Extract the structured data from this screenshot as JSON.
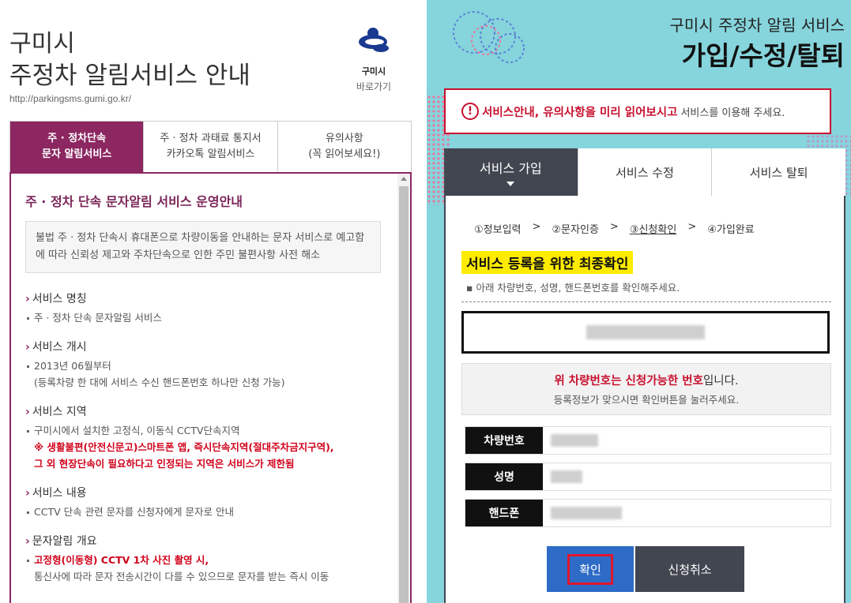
{
  "left": {
    "city": "구미시",
    "service_title": "주정차 알림서비스 안내",
    "url": "http://parkingsms.gumi.go.kr/",
    "gumi_link": {
      "name": "구미시",
      "go": "바로가기"
    },
    "tabs": [
      {
        "line1": "주 · 정차단속",
        "line2": "문자 알림서비스"
      },
      {
        "line1": "주 · 정차 과태료 통지서",
        "line2": "카카오톡 알림서비스"
      },
      {
        "line1": "유의사항",
        "line2": "(꼭 읽어보세요!)"
      }
    ],
    "content": {
      "heading": "주 · 정차 단속 문자알림 서비스 운영안내",
      "intro": "불법 주 · 정차 단속시 휴대폰으로 차량이동을 안내하는 문자 서비스로 예고함에 따라 신뢰성 제고와 주차단속으로 인한 주민 불편사항 사전 해소",
      "sections": [
        {
          "title": "서비스 명칭",
          "line": "주 · 정차 단속 문자알림 서비스"
        },
        {
          "title": "서비스 개시",
          "line": "2013년 06월부터",
          "line2": "(등록차량 한 대에 서비스 수신 핸드폰번호 하나만 신청 가능)"
        },
        {
          "title": "서비스 지역",
          "line": "구미시에서 설치한 고정식, 이동식 CCTV단속지역",
          "red1": "※ 생활불편(안전신문고)스마트폰 앱, 즉시단속지역(절대주차금지구역),",
          "red2": "그 외 현장단속이 필요하다고 인정되는 지역은 서비스가 제한됨"
        },
        {
          "title": "서비스 내용",
          "line": "CCTV 단속 관련 문자를 신청자에게 문자로 안내"
        },
        {
          "title": "문자알림 개요",
          "red_line": "고정형(이동형) CCTV 1차 사진 촬영 시,",
          "line2": "통신사에 따라 문자 전송시간이 다를 수 있으므로 문자를 받는 즉시 이동"
        }
      ]
    }
  },
  "right": {
    "subtitle": "구미시 주정차 알림 서비스",
    "title": "가입/수정/탈퇴",
    "notice_strong": "서비스안내, 유의사항을 미리 읽어보시고",
    "notice_rest": "서비스를 이용해 주세요.",
    "notice_icon": "!",
    "tabs": [
      "서비스 가입",
      "서비스 수정",
      "서비스 탈퇴"
    ],
    "steps": [
      "①정보입력",
      "②문자인증",
      "③신청확인",
      "④가입완료"
    ],
    "step_sep": ">",
    "confirm_title": "서비스 등록을 위한 최종확인",
    "confirm_note": "아래 차량번호, 성명, 핸드폰번호를 확인해주세요.",
    "status_red": "위 차량번호는 신청가능한 번호",
    "status_suffix": "입니다.",
    "status_line2": "등록정보가 맞으시면 확인버튼을 눌러주세요.",
    "info_labels": {
      "car": "차량번호",
      "name": "성명",
      "phone": "핸드폰"
    },
    "buttons": {
      "ok": "확인",
      "cancel": "신청취소"
    }
  }
}
